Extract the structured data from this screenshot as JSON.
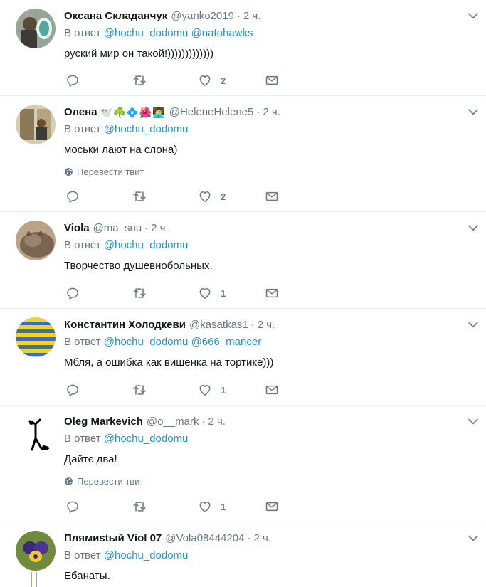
{
  "reply_prefix": "В ответ",
  "translate_label": "Перевести твит",
  "tweets": [
    {
      "name": "Оксана Складанчук",
      "emoji": "",
      "handle": "@yanko2019",
      "time": "2 ч.",
      "reply_to": [
        "@hochu_dodomu",
        "@natohawks"
      ],
      "text": "руский мир он такой!)))))))))))))",
      "has_translate": false,
      "likes": "2"
    },
    {
      "name": "Олена",
      "emoji": "🕊️☘️💠🌺👩‍💻",
      "handle": "@HeleneHelene5",
      "time": "2 ч.",
      "reply_to": [
        "@hochu_dodomu"
      ],
      "text": "моськи лают на слона)",
      "has_translate": true,
      "likes": "2"
    },
    {
      "name": "Viola",
      "emoji": "",
      "handle": "@ma_snu",
      "time": "2 ч.",
      "reply_to": [
        "@hochu_dodomu"
      ],
      "text": "Творчество душевнобольных.",
      "has_translate": false,
      "likes": "1"
    },
    {
      "name": "Константин Холодкеви",
      "emoji": "",
      "handle": "@kasatkas1",
      "time": "2 ч.",
      "reply_to": [
        "@hochu_dodomu",
        "@666_mancer"
      ],
      "text": "Мбля, а ошибка как вишенка на тортике)))",
      "has_translate": false,
      "likes": "1"
    },
    {
      "name": "Oleg Markevich",
      "emoji": "",
      "handle": "@o__mark",
      "time": "2 ч.",
      "reply_to": [
        "@hochu_dodomu"
      ],
      "text": "Дайтє два!",
      "has_translate": true,
      "likes": "1"
    },
    {
      "name": "Плямиstый Víol 07",
      "emoji": "",
      "handle": "@Vola08444204",
      "time": "2 ч.",
      "reply_to": [
        "@hochu_dodomu"
      ],
      "text": "Ебанаты.",
      "has_translate": false,
      "likes": ""
    }
  ]
}
